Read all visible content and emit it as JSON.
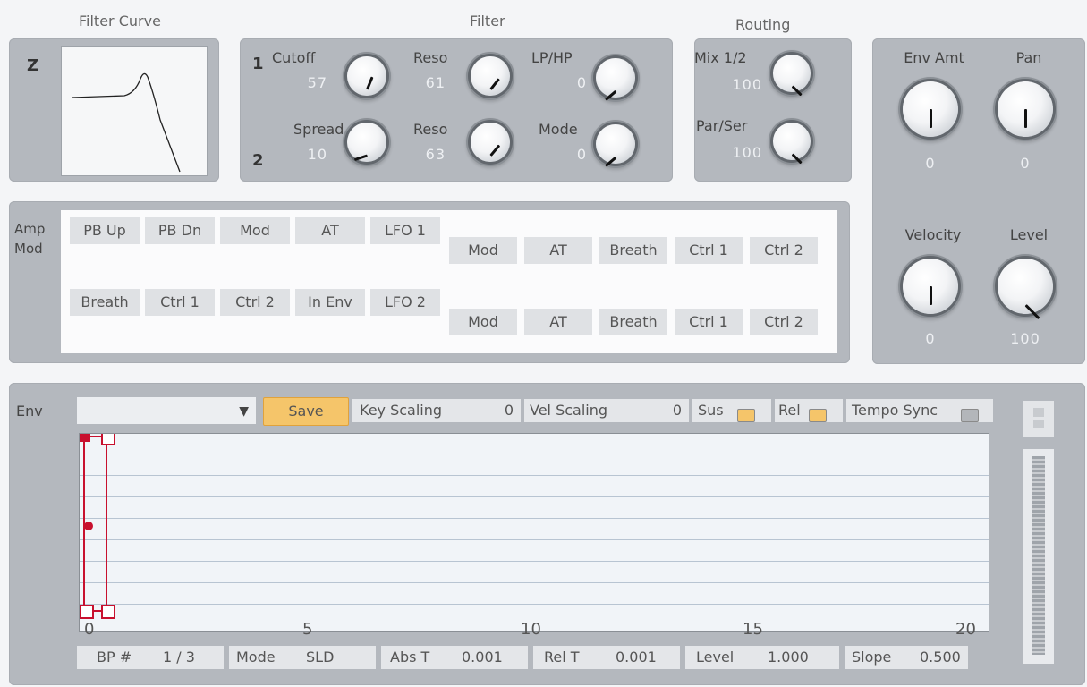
{
  "sections": {
    "filter_curve": "Filter Curve",
    "filter": "Filter",
    "routing": "Routing"
  },
  "filter_curve": {
    "label": "Z"
  },
  "filter": {
    "row1_number": "1",
    "row2_number": "2",
    "cutoff": {
      "label": "Cutoff",
      "value": "57"
    },
    "reso1": {
      "label": "Reso",
      "value": "61"
    },
    "lphp": {
      "label": "LP/HP",
      "value": "0"
    },
    "spread": {
      "label": "Spread",
      "value": "10"
    },
    "reso2": {
      "label": "Reso",
      "value": "63"
    },
    "mode": {
      "label": "Mode",
      "value": "0"
    }
  },
  "routing": {
    "mix": {
      "label": "Mix 1/2",
      "value": "100"
    },
    "parser": {
      "label": "Par/Ser",
      "value": "100"
    }
  },
  "right_panel": {
    "env_amt": {
      "label": "Env Amt",
      "value": "0"
    },
    "pan": {
      "label": "Pan",
      "value": "0"
    },
    "velocity": {
      "label": "Velocity",
      "value": "0"
    },
    "level": {
      "label": "Level",
      "value": "100"
    }
  },
  "amp_mod": {
    "label_line1": "Amp",
    "label_line2": "Mod",
    "row1": [
      "PB Up",
      "PB Dn",
      "Mod",
      "AT",
      "LFO 1"
    ],
    "row1_targets": [
      "Mod",
      "AT",
      "Breath",
      "Ctrl 1",
      "Ctrl 2"
    ],
    "row2": [
      "Breath",
      "Ctrl 1",
      "Ctrl 2",
      "In Env",
      "LFO 2"
    ],
    "row2_targets": [
      "Mod",
      "AT",
      "Breath",
      "Ctrl 1",
      "Ctrl 2"
    ]
  },
  "env": {
    "label": "Env",
    "save_label": "Save",
    "key_scaling": {
      "label": "Key Scaling",
      "value": "0"
    },
    "vel_scaling": {
      "label": "Vel Scaling",
      "value": "0"
    },
    "sus_label": "Sus",
    "rel_label": "Rel",
    "tempo_sync_label": "Tempo Sync",
    "axis_ticks": [
      "0",
      "5",
      "10",
      "15",
      "20"
    ],
    "footer": {
      "bp_label": "BP #",
      "bp_value": "1 / 3",
      "mode_label": "Mode",
      "mode_value": "SLD",
      "abst_label": "Abs T",
      "abst_value": "0.001",
      "relt_label": "Rel T",
      "relt_value": "0.001",
      "level_label": "Level",
      "level_value": "1.000",
      "slope_label": "Slope",
      "slope_value": "0.500"
    }
  },
  "colors": {
    "panel": "#b4b8be",
    "accent_orange": "#f5c56a",
    "envelope_red": "#c8102e"
  }
}
